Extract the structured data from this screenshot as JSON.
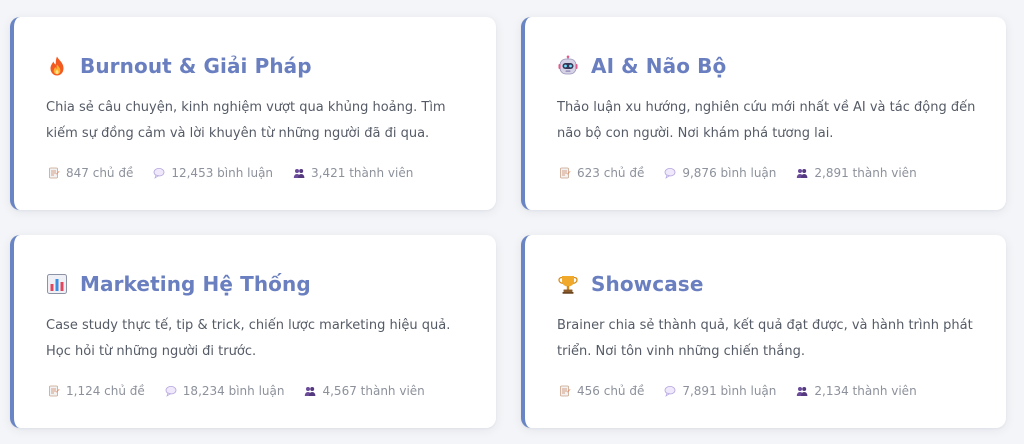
{
  "cards": [
    {
      "icon": "fire-icon",
      "title": "Burnout & Giải Pháp",
      "description": "Chia sẻ câu chuyện, kinh nghiệm vượt qua khủng hoảng. Tìm kiếm sự đồng cảm và lời khuyên từ những người đã đi qua.",
      "topics": "847 chủ đề",
      "comments": "12,453 bình luận",
      "members": "3,421 thành viên"
    },
    {
      "icon": "robot-icon",
      "title": "AI & Não Bộ",
      "description": "Thảo luận xu hướng, nghiên cứu mới nhất về AI và tác động đến não bộ con người. Nơi khám phá tương lai.",
      "topics": "623 chủ đề",
      "comments": "9,876 bình luận",
      "members": "2,891 thành viên"
    },
    {
      "icon": "bar-chart-icon",
      "title": "Marketing Hệ Thống",
      "description": "Case study thực tế, tip & trick, chiến lược marketing hiệu quả. Học hỏi từ những người đi trước.",
      "topics": "1,124 chủ đề",
      "comments": "18,234 bình luận",
      "members": "4,567 thành viên"
    },
    {
      "icon": "trophy-icon",
      "title": "Showcase",
      "description": "Brainer chia sẻ thành quả, kết quả đạt được, và hành trình phát triển. Nơi tôn vinh những chiến thắng.",
      "topics": "456 chủ đề",
      "comments": "7,891 bình luận",
      "members": "2,134 thành viên"
    }
  ],
  "colors": {
    "accent": "#6a85c4",
    "title": "#6a7fc0",
    "text": "#555b66",
    "muted": "#8c919b"
  }
}
